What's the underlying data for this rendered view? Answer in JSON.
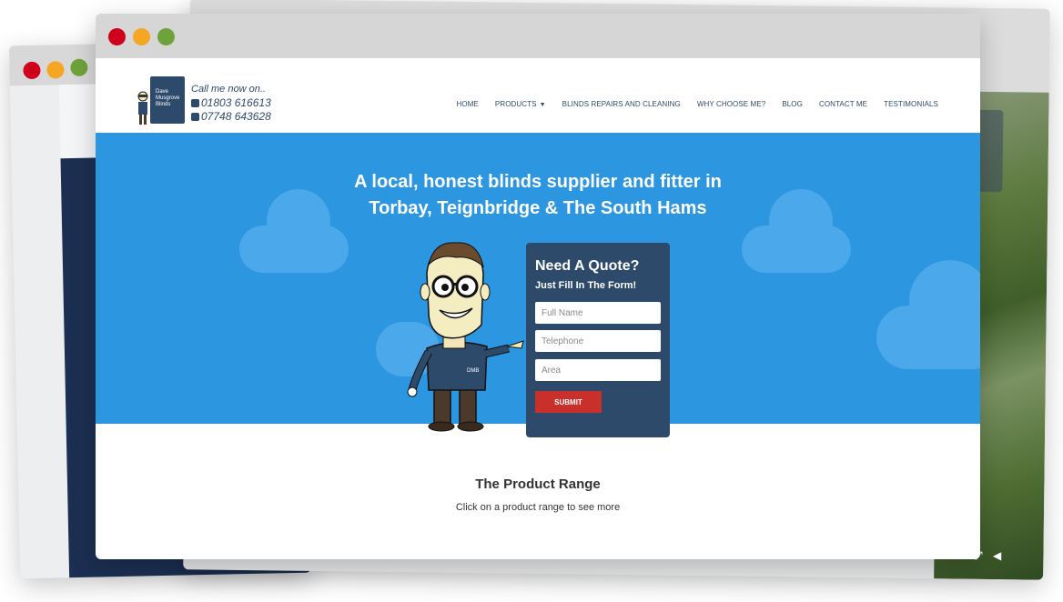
{
  "header": {
    "logo_lines": [
      "Dave",
      "Musgrove",
      "Blinds"
    ],
    "call_label": "Call me now on..",
    "phones": [
      "01803 616613",
      "07748 643628"
    ]
  },
  "nav": {
    "items": [
      "HOME",
      "PRODUCTS",
      "BLINDS REPAIRS AND CLEANING",
      "WHY CHOOSE ME?",
      "BLOG",
      "CONTACT ME",
      "TESTIMONIALS"
    ]
  },
  "hero": {
    "title_line1": "A local, honest blinds supplier and fitter in",
    "title_line2": "Torbay, Teignbridge & The South Hams"
  },
  "quote_form": {
    "title": "Need A Quote?",
    "subtitle": "Just Fill In The Form!",
    "name_placeholder": "Full Name",
    "phone_placeholder": "Telephone",
    "area_placeholder": "Area",
    "submit_label": "SUBMIT"
  },
  "products": {
    "title": "The Product Range",
    "subtitle": "Click on a product range to see more"
  },
  "colors": {
    "hero_bg": "#2d96e0",
    "navy": "#2e4a6b",
    "submit": "#c9302c",
    "traffic_red": "#d0021b",
    "traffic_yellow": "#f5a623",
    "traffic_green": "#6ea33b"
  }
}
